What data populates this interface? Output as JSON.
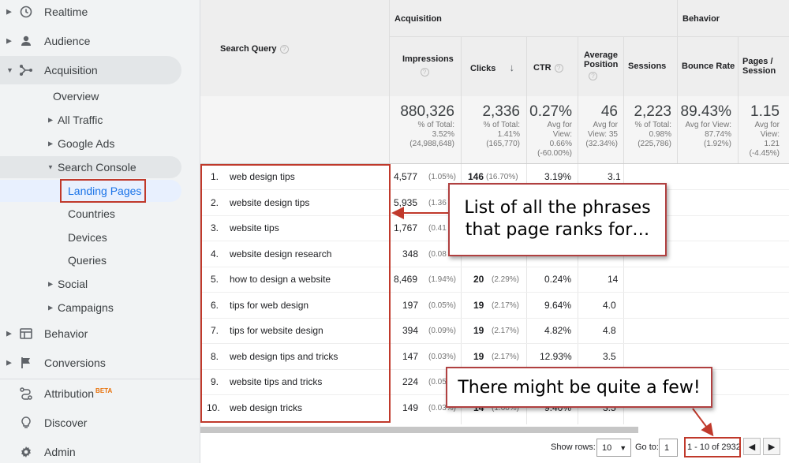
{
  "colors": {
    "accent": "#1a73e8",
    "annotation_red": "#c0392b",
    "sidebar_bg": "#f1f3f4"
  },
  "sidebar": {
    "top": [
      {
        "label": "Realtime",
        "icon": "clock-icon"
      },
      {
        "label": "Audience",
        "icon": "person-icon"
      },
      {
        "label": "Acquisition",
        "icon": "acquisition-icon"
      },
      {
        "label": "Behavior",
        "icon": "behavior-icon"
      },
      {
        "label": "Conversions",
        "icon": "flag-icon"
      },
      {
        "label": "Attribution",
        "icon": "attribution-icon",
        "badge": "BETA"
      },
      {
        "label": "Discover",
        "icon": "lightbulb-icon"
      },
      {
        "label": "Admin",
        "icon": "gear-icon"
      }
    ],
    "acq": {
      "overview": "Overview",
      "all_traffic": "All Traffic",
      "google_ads": "Google Ads",
      "search_console": "Search Console",
      "landing_pages": "Landing Pages",
      "countries": "Countries",
      "devices": "Devices",
      "queries": "Queries",
      "social": "Social",
      "campaigns": "Campaigns"
    }
  },
  "table": {
    "group_acquisition": "Acquisition",
    "group_behavior": "Behavior",
    "col_query": "Search Query",
    "col_impressions": "Impressions",
    "col_clicks": "Clicks",
    "col_ctr": "CTR",
    "col_avg_position_1": "Average",
    "col_avg_position_2": "Position",
    "col_sessions": "Sessions",
    "col_bounce_rate": "Bounce Rate",
    "col_pages_session_1": "Pages /",
    "col_pages_session_2": "Session",
    "summary": {
      "impressions": {
        "value": "880,326",
        "l1": "% of Total:",
        "l2": "3.52%",
        "l3": "(24,988,648)"
      },
      "clicks": {
        "value": "2,336",
        "l1": "% of Total:",
        "l2": "1.41%",
        "l3": "(165,770)"
      },
      "ctr": {
        "value": "0.27%",
        "l1": "Avg for",
        "l2": "View:",
        "l3": "0.66%",
        "l4": "(-60.00%)"
      },
      "position": {
        "value": "46",
        "l1": "Avg for",
        "l2": "View: 35",
        "l3": "(32.34%)"
      },
      "sessions": {
        "value": "2,223",
        "l1": "% of Total:",
        "l2": "0.98%",
        "l3": "(225,786)"
      },
      "bounce": {
        "value": "89.43%",
        "l1": "Avg for View:",
        "l2": "87.74%",
        "l3": "(1.92%)"
      },
      "pages": {
        "value": "1.15",
        "l1": "Avg for",
        "l2": "View:",
        "l3": "1.21",
        "l4": "(-4.45%)"
      }
    },
    "rows": [
      {
        "num": "1.",
        "query": "web design tips",
        "impressions": "4,577",
        "imp_pct": "(1.05%)",
        "clicks": "146",
        "clk_pct": "(16.70%)",
        "ctr": "3.19%",
        "position": "3.1"
      },
      {
        "num": "2.",
        "query": "website design tips",
        "impressions": "5,935",
        "imp_pct": "(1.36",
        "clicks": "",
        "clk_pct": "",
        "ctr": "",
        "position": ""
      },
      {
        "num": "3.",
        "query": "website tips",
        "impressions": "1,767",
        "imp_pct": "(0.41",
        "clicks": "",
        "clk_pct": "",
        "ctr": "",
        "position": ""
      },
      {
        "num": "4.",
        "query": "website design research",
        "impressions": "348",
        "imp_pct": "(0.08",
        "clicks": "",
        "clk_pct": "",
        "ctr": "",
        "position": ""
      },
      {
        "num": "5.",
        "query": "how to design a website",
        "impressions": "8,469",
        "imp_pct": "(1.94%)",
        "clicks": "20",
        "clk_pct": "(2.29%)",
        "ctr": "0.24%",
        "position": "14"
      },
      {
        "num": "6.",
        "query": "tips for web design",
        "impressions": "197",
        "imp_pct": "(0.05%)",
        "clicks": "19",
        "clk_pct": "(2.17%)",
        "ctr": "9.64%",
        "position": "4.0"
      },
      {
        "num": "7.",
        "query": "tips for website design",
        "impressions": "394",
        "imp_pct": "(0.09%)",
        "clicks": "19",
        "clk_pct": "(2.17%)",
        "ctr": "4.82%",
        "position": "4.8"
      },
      {
        "num": "8.",
        "query": "web design tips and tricks",
        "impressions": "147",
        "imp_pct": "(0.03%)",
        "clicks": "19",
        "clk_pct": "(2.17%)",
        "ctr": "12.93%",
        "position": "3.5"
      },
      {
        "num": "9.",
        "query": "website tips and tricks",
        "impressions": "224",
        "imp_pct": "(0.05",
        "clicks": "",
        "clk_pct": "",
        "ctr": "",
        "position": ""
      },
      {
        "num": "10.",
        "query": "web design tricks",
        "impressions": "149",
        "imp_pct": "(0.03%)",
        "clicks": "14",
        "clk_pct": "(1.60%)",
        "ctr": "9.40%",
        "position": "3.5"
      }
    ]
  },
  "footer": {
    "show_rows_label": "Show rows:",
    "show_rows_value": "10",
    "goto_label": "Go to:",
    "goto_value": "1",
    "range": "1 - 10 of 2932"
  },
  "annotations": {
    "callout1_line1": "List of all the phrases",
    "callout1_line2": "that page ranks for…",
    "callout2": "There might be quite a few!"
  }
}
